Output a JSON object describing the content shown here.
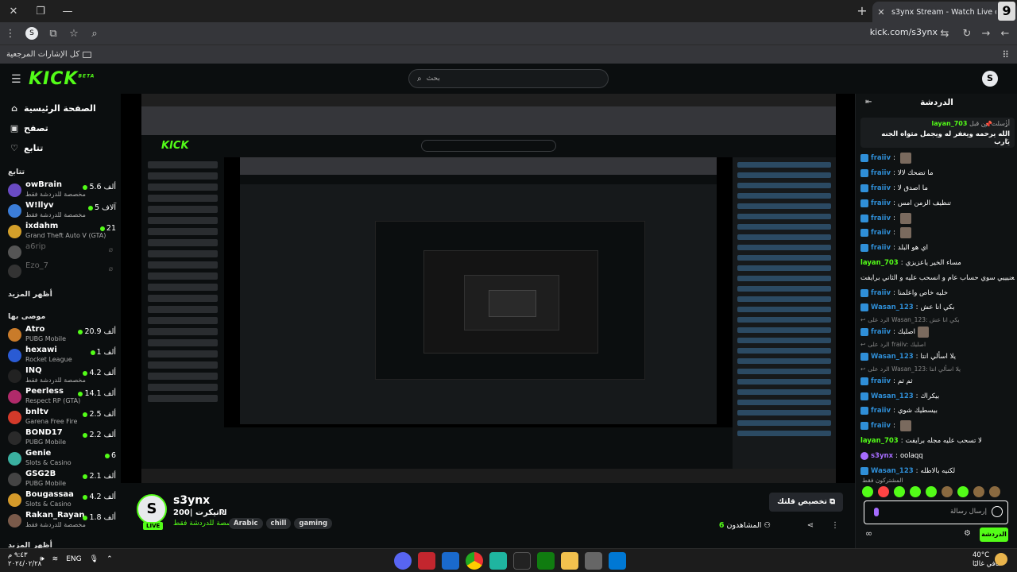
{
  "browser": {
    "tab_title": "s3ynx Stream - Watch Live on Kick",
    "profile_badge": "9",
    "url": "kick.com/s3ynx",
    "bookmarks_label": "كل الإشارات المرجعية",
    "new_tab": "+"
  },
  "kick": {
    "logo": "KICK",
    "logo_beta": "BETA",
    "search_placeholder": "بحث",
    "user_initial": "S"
  },
  "sidebar": {
    "nav": [
      {
        "label": "الصفحة الرئيسية",
        "icon": "home-icon"
      },
      {
        "label": "تصفح",
        "icon": "browse-icon"
      },
      {
        "label": "تتابع",
        "icon": "heart-icon"
      }
    ],
    "following_title": "تتابع",
    "following": [
      {
        "name": "owBrain",
        "game": "مخصصة للدردشة فقط",
        "viewers": "5.6 ألف",
        "color": "#6a4bc4"
      },
      {
        "name": "W!llyv",
        "game": "مخصصة للدردشة فقط",
        "viewers": "5 آلاف",
        "color": "#3b7dd8"
      },
      {
        "name": "ixdahm",
        "game": "Grand Theft Auto V (GTA)",
        "viewers": "21",
        "color": "#d4a02a"
      },
      {
        "name": "a6rip",
        "game": "",
        "viewers": "",
        "color": "#555"
      },
      {
        "name": "Ezo_7",
        "game": "",
        "viewers": "",
        "color": "#333"
      }
    ],
    "show_more": "أظهر المزيد",
    "recommended_title": "موصى بها",
    "recommended": [
      {
        "name": "Atro",
        "game": "PUBG Mobile",
        "viewers": "20.9 ألف",
        "color": "#c97b2a"
      },
      {
        "name": "hexawi",
        "game": "Rocket League",
        "viewers": "1 ألف",
        "color": "#2a5bd4"
      },
      {
        "name": "INQ",
        "game": "مخصصة للدردشة فقط",
        "viewers": "4.2 ألف",
        "color": "#222"
      },
      {
        "name": "Peerless",
        "game": "Respect RP (GTA)",
        "viewers": "14.1 ألف",
        "color": "#b02a6a"
      },
      {
        "name": "bnltv",
        "game": "Garena Free Fire",
        "viewers": "2.5 ألف",
        "color": "#d43a2a"
      },
      {
        "name": "BOND17",
        "game": "PUBG Mobile",
        "viewers": "2.2 ألف",
        "color": "#2a2a2a"
      },
      {
        "name": "Genie",
        "game": "Slots & Casino",
        "viewers": "6",
        "color": "#3ab0a0"
      },
      {
        "name": "GSG2B",
        "game": "PUBG Mobile",
        "viewers": "2.1 ألف",
        "color": "#444"
      },
      {
        "name": "Bougassaa",
        "game": "Slots & Casino",
        "viewers": "4.2 ألف",
        "color": "#d49a2a"
      },
      {
        "name": "Rakan_Rayan",
        "game": "مخصصة للدردشة فقط",
        "viewers": "1.8 ألف",
        "color": "#7a5a4a"
      }
    ],
    "show_more_bottom": "أظهر المزيد"
  },
  "stream": {
    "avatar_initial": "S",
    "live_label": "LIVE",
    "name": "s3ynx",
    "title": "تيكرت |200₪",
    "category": "مخصصة للدردشة فقط",
    "tags": [
      "Arabic",
      "chill",
      "gaming"
    ],
    "clip_button": "تخصيص قلتك",
    "viewers_label": "المشاهدون",
    "viewers_count": "6"
  },
  "chat": {
    "title": "الدردشة",
    "pinned_by_prefix": "أرسلت من قبل",
    "pinned_by_user": "layan_703",
    "pinned_text": "الله يرحمه ويغفر له ويجمل مثواه الجنه يارب",
    "messages": [
      {
        "user": "fraiiv",
        "text": "",
        "type": "blue",
        "emote": true
      },
      {
        "user": "fraiiv",
        "text": "ما تضحك لالا",
        "type": "blue"
      },
      {
        "user": "fraiiv",
        "text": "ما اصدق لا",
        "type": "blue"
      },
      {
        "user": "fraiiv",
        "text": "تنظيف الزمن امس",
        "type": "blue"
      },
      {
        "user": "fraiiv",
        "text": "",
        "type": "blue",
        "emote": true
      },
      {
        "user": "fraiiv",
        "text": "",
        "type": "blue",
        "emote": true
      },
      {
        "user": "fraiiv",
        "text": "اي هو البلد",
        "type": "blue"
      },
      {
        "user": "layan_703",
        "text": "مساء الخير ياعزيزي",
        "type": "green"
      },
      {
        "user": "",
        "text": "يعنيييي سوي حساب عام و انسحب عليه و الثاني برايفت",
        "type": "plain"
      },
      {
        "user": "fraiiv",
        "text": "خليه خاص واعلمنا",
        "type": "blue"
      },
      {
        "user": "Wasan_123",
        "text": "بكي انا عش",
        "type": "blue"
      },
      {
        "user": "",
        "text": "الرد على Wasan_123: بكي انا عش",
        "type": "reply"
      },
      {
        "user": "fraiiv",
        "text": "اصلبك",
        "type": "blue",
        "emote": true
      },
      {
        "user": "",
        "text": "الرد على fraiiv: اصلبك",
        "type": "reply"
      },
      {
        "user": "Wasan_123",
        "text": "يلا اسألي انتا",
        "type": "blue"
      },
      {
        "user": "",
        "text": "الرد على Wasan_123: يلا اسألي انتا",
        "type": "reply"
      },
      {
        "user": "fraiiv",
        "text": "ثم ثم",
        "type": "blue"
      },
      {
        "user": "Wasan_123",
        "text": "بيكراك",
        "type": "blue"
      },
      {
        "user": "fraiiv",
        "text": "بيسطيك شوي",
        "type": "blue"
      },
      {
        "user": "fraiiv",
        "text": "",
        "type": "blue",
        "emote": true
      },
      {
        "user": "layan_703",
        "text": "لا تسحب عليه مجله برايفت",
        "type": "green"
      },
      {
        "user": "s3ynx",
        "text": "oolaqq",
        "type": "purple"
      },
      {
        "user": "Wasan_123",
        "text": "لكنيه بالاطله",
        "type": "blue"
      }
    ],
    "emotes_label": "المشتركون فقط",
    "input_placeholder": "إرسال رسالة",
    "send_button": "الدردشة"
  },
  "taskbar": {
    "time": "٩:٤٣ م",
    "date": "٢٠٢٤/٠٢/٢٨",
    "lang": "ENG",
    "temp": "40°C",
    "weather": "صافي غالبًا"
  }
}
